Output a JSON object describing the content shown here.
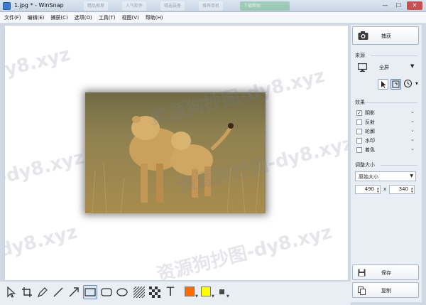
{
  "window": {
    "title": "1.jpg * - WinSnap",
    "faded_tabs": [
      "精品推荐",
      "人气软件",
      "精选装备",
      "推荐单机",
      "下载帮助"
    ],
    "controls": {
      "minimize": "—",
      "maximize": "☐",
      "close": "✕"
    }
  },
  "menu": {
    "items": [
      "文件(F)",
      "编辑(E)",
      "捕获(C)",
      "选项(O)",
      "工具(T)",
      "视图(V)",
      "帮助(H)"
    ]
  },
  "watermark": {
    "text": "资源狗抄图-dy8.xyz",
    "short": "-dy8.xyz"
  },
  "panel": {
    "capture_label": "捕获",
    "source": {
      "title": "来源",
      "value": "全屏",
      "icons": [
        "pointer-icon",
        "window-mode-icon",
        "timer-icon"
      ]
    },
    "effects": {
      "title": "效果",
      "items": [
        {
          "label": "阴影",
          "checked": true
        },
        {
          "label": "反射",
          "checked": false
        },
        {
          "label": "轮廓",
          "checked": false
        },
        {
          "label": "水印",
          "checked": false
        },
        {
          "label": "着色",
          "checked": false
        }
      ]
    },
    "resize": {
      "title": "调整大小",
      "mode": "原始大小",
      "width": "490",
      "height": "340",
      "separator": "x"
    },
    "save_label": "保存",
    "copy_label": "复制"
  },
  "toolbar": {
    "tools": [
      "select-tool",
      "crop-tool",
      "pen-tool",
      "line-tool",
      "arrow-tool",
      "rectangle-tool",
      "rounded-rectangle-tool",
      "ellipse-tool",
      "hatch-tool",
      "pixelate-tool",
      "text-tool"
    ],
    "text_tool_label": "T",
    "active_tool": "rectangle-tool",
    "colors": {
      "primary": "#ff6a00",
      "secondary": "#ffff00",
      "outline": "#4a4a4a"
    }
  }
}
